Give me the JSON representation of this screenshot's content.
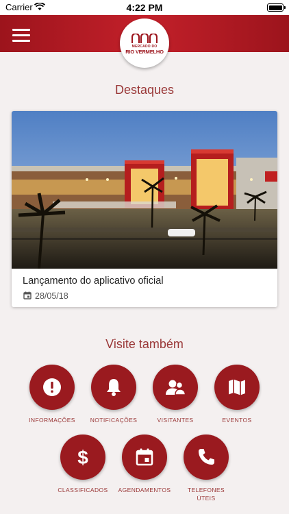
{
  "status_bar": {
    "carrier": "Carrier",
    "time": "4:22 PM"
  },
  "header": {
    "logo_line1": "MERCADO DO",
    "logo_line2": "RIO VERMELHO",
    "brand_color": "#b51a22"
  },
  "highlights": {
    "title": "Destaques",
    "card": {
      "title": "Lançamento do aplicativo oficial",
      "date": "28/05/18"
    }
  },
  "visit": {
    "title": "Visite também",
    "items": [
      {
        "label": "INFORMAÇÕES",
        "icon": "info-icon"
      },
      {
        "label": "NOTIFICAÇÕES",
        "icon": "bell-icon"
      },
      {
        "label": "VISITANTES",
        "icon": "people-icon"
      },
      {
        "label": "EVENTOS",
        "icon": "map-icon"
      },
      {
        "label": "CLASSIFICADOS",
        "icon": "dollar-icon"
      },
      {
        "label": "AGENDAMENTOS",
        "icon": "calendar-icon"
      },
      {
        "label": "TELEFONES\nÚTEIS",
        "icon": "phone-icon"
      }
    ]
  }
}
